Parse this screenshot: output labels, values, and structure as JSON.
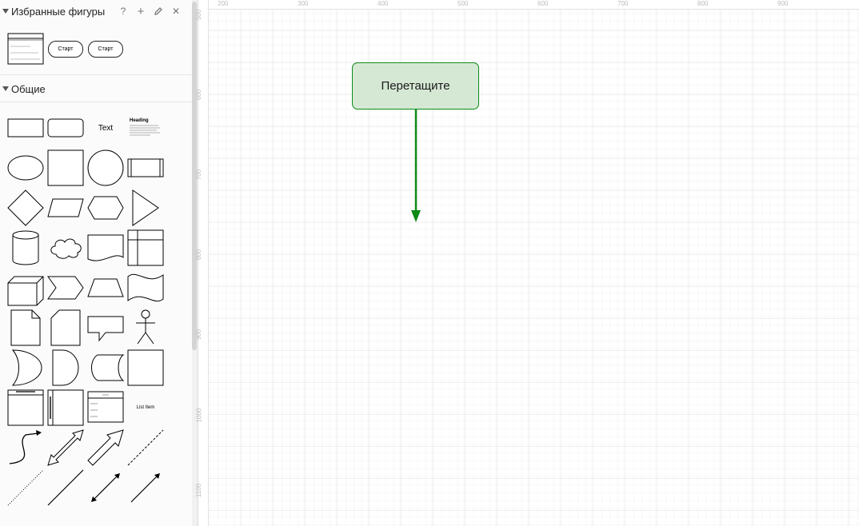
{
  "sidebar": {
    "favorites": {
      "title": "Избранные фигуры",
      "tools": {
        "help": "?",
        "add": "+",
        "edit_icon": "pencil-icon",
        "close": "✕"
      },
      "items": [
        {
          "type": "table",
          "icon": "table-shape-icon"
        },
        {
          "type": "terminator",
          "label": "Старт"
        },
        {
          "type": "terminator",
          "label": "Старт"
        }
      ]
    },
    "general": {
      "title": "Общие",
      "text_label": "Text",
      "heading_label": "Heading",
      "list_label": "List Item",
      "shapes": [
        "rectangle",
        "rounded-rectangle",
        "text",
        "textbox",
        "ellipse",
        "square",
        "circle",
        "process",
        "diamond",
        "parallelogram",
        "hexagon",
        "triangle",
        "cylinder",
        "cloud",
        "document",
        "internal-storage",
        "cube",
        "step",
        "trapezoid",
        "tape",
        "note",
        "card",
        "callout",
        "actor",
        "or",
        "and",
        "data-storage",
        "frame",
        "container",
        "swimlane",
        "list",
        "list-item",
        "curve",
        "bidirectional-arrow",
        "arrow",
        "dashed-line",
        "dotted-line",
        "line",
        "bidirectional-connector",
        "directional-connector"
      ]
    }
  },
  "canvas": {
    "ruler_top": [
      "200",
      "300",
      "400",
      "500",
      "600",
      "700",
      "800",
      "900"
    ],
    "ruler_left": [
      "500",
      "600",
      "700",
      "800",
      "900",
      "1000",
      "1100"
    ],
    "node": {
      "label": "Перетащите",
      "fill": "#d5e8d4",
      "stroke": "#0e8a16"
    },
    "edge": {
      "color": "#0e8a16"
    }
  }
}
